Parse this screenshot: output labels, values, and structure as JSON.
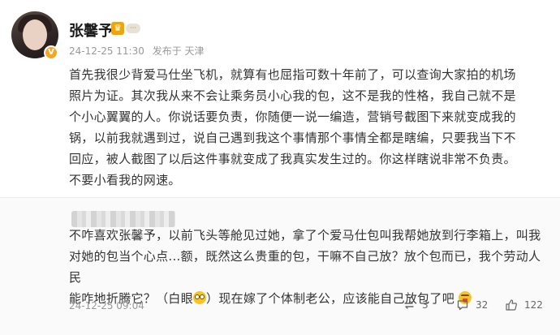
{
  "post": {
    "username": "张馨予",
    "verified_mark": "V",
    "vip_mark": "♛",
    "svip_tag": "···",
    "time": "24-12-25 11:30",
    "source": "发布于 天津",
    "lines": [
      "首先我很少背爱马仕坐飞机，就算有也屈指可数十年前了，可以查询大家拍的机场",
      "照片为证。其次我从来不会让乘务员小心我的包，这不是我的性格，我自己就不是",
      "个小心翼翼的人。你说话要负责，你随便一说一编造，营销号截图下来就变成我的",
      "锅，以前我就遇到过，说自己遇到我这个事情那个事情全都是瞎编，只要我当下不",
      "回应，被人截图了以后这件事就变成了我真实发生过的。你这样瞎说非常不负责。",
      "不要小看我的网速。"
    ]
  },
  "comment": {
    "line1": "不咋喜欢张馨予，以前飞头等舱见过她，拿了个爱马仕包叫我帮她放到行李箱上，叫我",
    "line2": "对她的包当个心点...额，既然这么贵重的包，干嘛不自己放？放个包而已，我个劳动人民",
    "line3_a": "能咋地折腾它？（白眼",
    "line3_b": "）现在嫁了个体制老公，应该能自己放包了吧",
    "time": "24-12-25 09:04",
    "reposts": "3",
    "comments": "32",
    "likes": "122"
  },
  "icons": {
    "repost": "repost-icon",
    "comment": "comment-icon",
    "like": "like-icon",
    "eye_roll": "eye-roll-emoji",
    "tongue": "tongue-emoji"
  },
  "colors": {
    "text": "#333333",
    "meta": "#999999",
    "vip": "#f0a500",
    "comment_bg": "#fafafa"
  }
}
